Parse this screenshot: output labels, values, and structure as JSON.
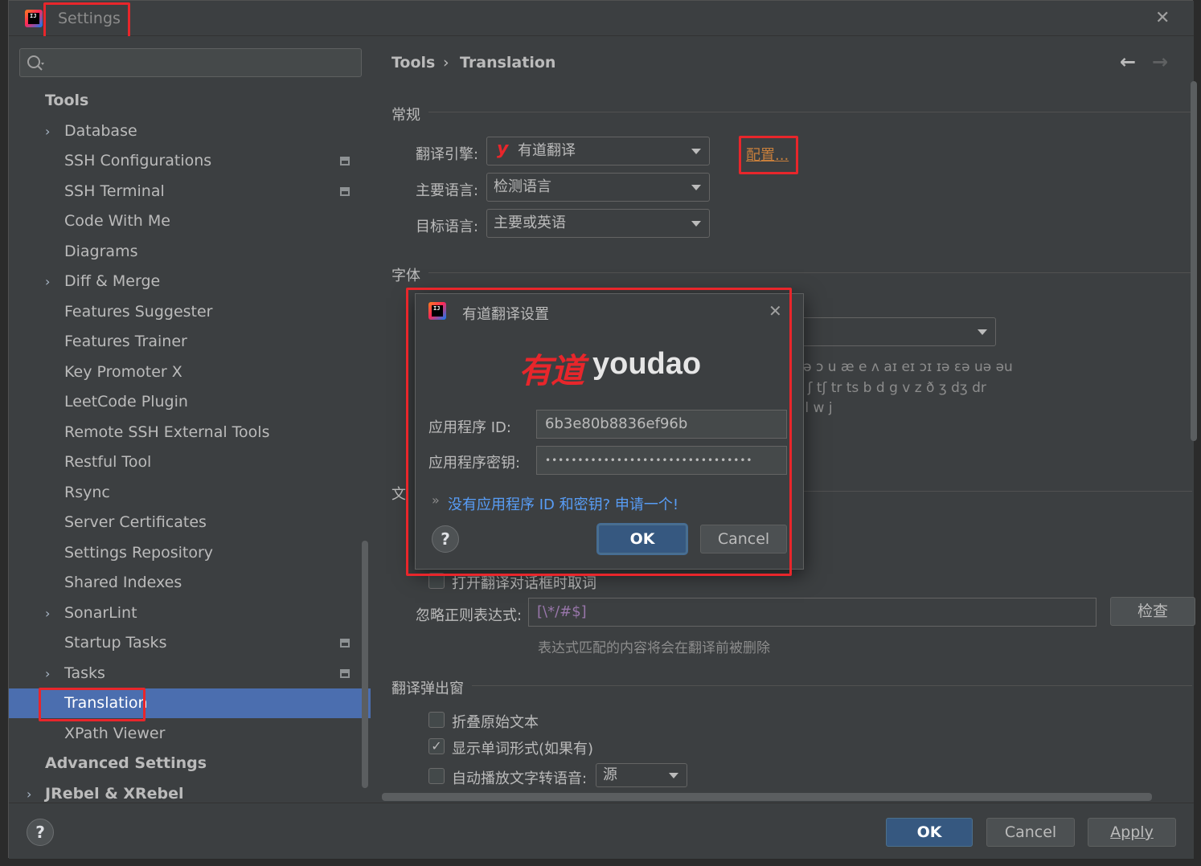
{
  "window": {
    "title": "Settings",
    "close_glyph": "✕"
  },
  "sidebar": {
    "search_placeholder": "",
    "items": [
      {
        "label": "Tools"
      },
      {
        "label": "Database"
      },
      {
        "label": "SSH Configurations"
      },
      {
        "label": "SSH Terminal"
      },
      {
        "label": "Code With Me"
      },
      {
        "label": "Diagrams"
      },
      {
        "label": "Diff & Merge"
      },
      {
        "label": "Features Suggester"
      },
      {
        "label": "Features Trainer"
      },
      {
        "label": "Key Promoter X"
      },
      {
        "label": "LeetCode Plugin"
      },
      {
        "label": "Remote SSH External Tools"
      },
      {
        "label": "Restful Tool"
      },
      {
        "label": "Rsync"
      },
      {
        "label": "Server Certificates"
      },
      {
        "label": "Settings Repository"
      },
      {
        "label": "Shared Indexes"
      },
      {
        "label": "SonarLint"
      },
      {
        "label": "Startup Tasks"
      },
      {
        "label": "Tasks"
      },
      {
        "label": "Translation"
      },
      {
        "label": "XPath Viewer"
      },
      {
        "label": "Advanced Settings"
      },
      {
        "label": "JRebel & XRebel"
      }
    ],
    "selected_item": "Translation"
  },
  "breadcrumb": {
    "parent": "Tools",
    "separator": "›",
    "current": "Translation",
    "back_glyph": "←",
    "forward_glyph": "→"
  },
  "general": {
    "section_title": "常规",
    "engine_label": "翻译引擎:",
    "engine_value": "有道翻译",
    "engine_icon_glyph": "y",
    "configure_link": "配置...",
    "primary_lang_label": "主要语言:",
    "primary_lang_value": "检测语言",
    "target_lang_label": "目标语言:",
    "target_lang_value": "主要或英语"
  },
  "font": {
    "section_title": "字体",
    "phonetic_line1": "i ə ɔ u æ e ʌ aɪ eɪ ɔɪ ɪə ɛə uə əu",
    "phonetic_line2": "θ ʃ tʃ tr ts b d g v z ð ʒ dʒ dr",
    "phonetic_line3": "r l w j"
  },
  "text_section": {
    "section_title_partial": "文",
    "take_word_label": "打开翻译对话框时取词",
    "ignore_regex_label": "忽略正则表达式:",
    "ignore_regex_value": "[\\*/#$]",
    "check_button": "检查",
    "regex_hint": "表达式匹配的内容将会在翻译前被删除"
  },
  "popup": {
    "section_title": "翻译弹出窗",
    "fold_original_label": "折叠原始文本",
    "fold_original_checked": false,
    "show_word_forms_label": "显示单词形式(如果有)",
    "show_word_forms_checked": true,
    "auto_play_tts_label": "自动播放文字转语音:",
    "auto_play_tts_checked": false,
    "auto_play_tts_value": "源"
  },
  "dialog": {
    "title": "有道翻译设置",
    "logo_cn": "有道",
    "logo_en": "youdao",
    "app_id_label": "应用程序 ID:",
    "app_id_value": "6b3e80b8836ef96b",
    "app_key_label": "应用程序密钥:",
    "app_key_value": "••••••••••••••••••••••••••••••••",
    "apply_link_prefix": "»",
    "apply_link": "没有应用程序 ID 和密钥? 申请一个!",
    "help_glyph": "?",
    "ok_button": "OK",
    "cancel_button": "Cancel",
    "close_glyph": "✕"
  },
  "footer": {
    "help_glyph": "?",
    "ok_button": "OK",
    "cancel_button": "Cancel",
    "apply_button": "Apply"
  },
  "colors": {
    "accent_selection": "#4b6eaf",
    "primary_button": "#365880",
    "highlight_border": "#e8262b",
    "link": "#589df6",
    "configure_link": "#c77f3c",
    "youdao_red": "#e8262b"
  }
}
